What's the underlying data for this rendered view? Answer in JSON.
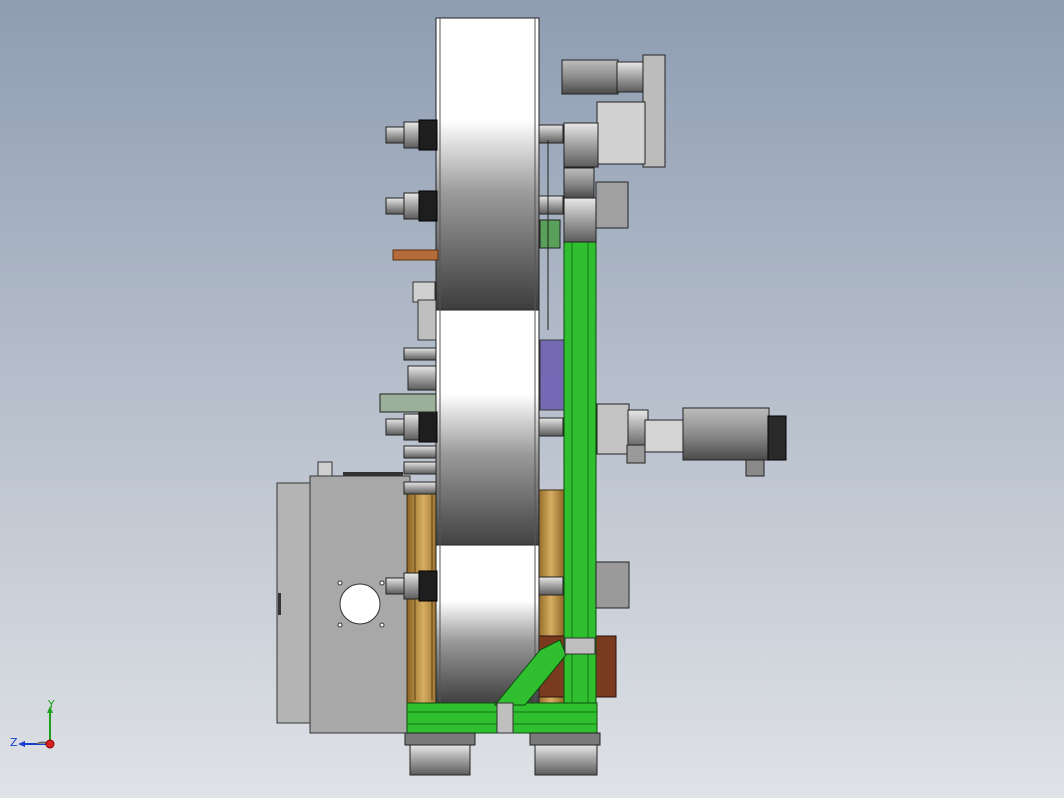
{
  "viewport": {
    "background_top": "#8f9db2",
    "background_bottom": "#dfe2e6"
  },
  "colors": {
    "frame_green": "#2fbf2f",
    "frame_green_dark": "#137a13",
    "wood": "#c89a50",
    "wood_dark": "#8a6322",
    "copper": "#b36b3a",
    "brown_plate": "#7a3a1f",
    "grey_box": "#9a9a9a",
    "cylinder_light": "#ffffff",
    "cylinder_dark": "#3d3d3d"
  },
  "triad": {
    "y_label": "Y",
    "z_label": "Z"
  }
}
